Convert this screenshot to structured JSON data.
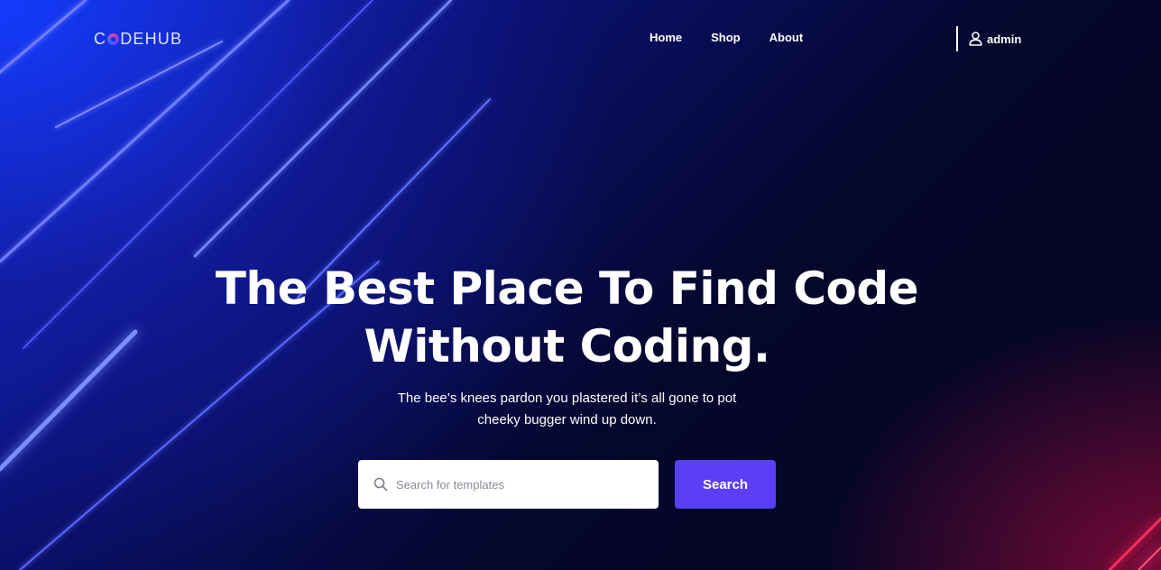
{
  "brand": {
    "logo_prefix": "C",
    "logo_suffix": "DEHUB",
    "accent_colors": [
      "#e33bb0",
      "#7a3cff",
      "#2f73ff"
    ]
  },
  "nav": {
    "items": [
      {
        "label": "Home"
      },
      {
        "label": "Shop"
      },
      {
        "label": "About"
      }
    ]
  },
  "user": {
    "name": "admin",
    "icon": "user-icon"
  },
  "hero": {
    "title_line1": "The Best Place To Find Code",
    "title_line2": "Without Coding.",
    "subtitle_line1": "The bee’s knees pardon you plastered it’s all gone to pot",
    "subtitle_line2": "cheeky bugger wind up down."
  },
  "search": {
    "placeholder": "Search for templates",
    "value": "",
    "icon": "search-icon",
    "button_label": "Search",
    "button_color": "#5a3ff7"
  },
  "theme": {
    "background_dark": "#05072c",
    "background_blue": "#0f2bd6",
    "neon_line": "#5a6bff",
    "neon_red": "#ff2a5a"
  }
}
